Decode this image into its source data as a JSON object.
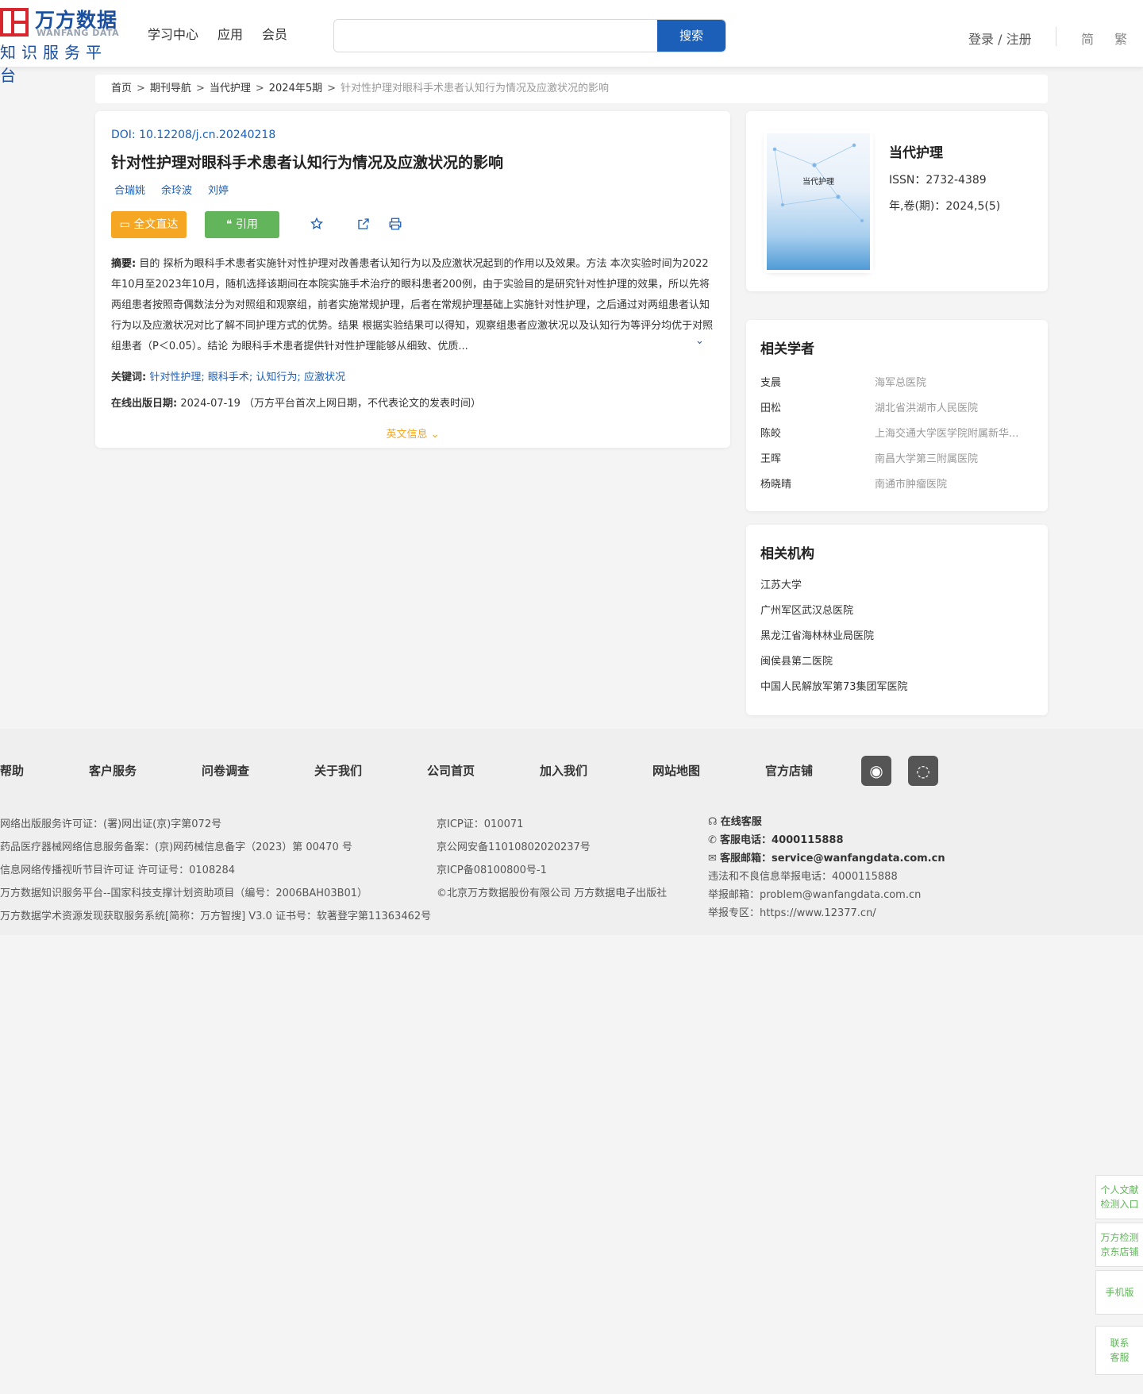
{
  "header": {
    "brand_cn": "万方数据",
    "brand_en": "WANFANG DATA",
    "brand_sub": "知识服务平台",
    "nav": [
      "学习中心",
      "应用",
      "会员"
    ],
    "search_placeholder": "",
    "search_button": "搜索",
    "login": "登录 / 注册",
    "lang_simplified": "简",
    "lang_traditional": "繁"
  },
  "breadcrumb": {
    "items": [
      "首页",
      "期刊导航",
      "当代护理",
      "2024年5期"
    ],
    "separator": ">",
    "current": "针对性护理对眼科手术患者认知行为情况及应激状况的影响"
  },
  "article": {
    "doi_label": "DOI: ",
    "doi": "10.12208/j.cn.20240218",
    "title": "针对性护理对眼科手术患者认知行为情况及应激状况的影响",
    "authors": [
      "合瑞姚",
      "余玲波",
      "刘婷"
    ],
    "full_text_button": "全文直达",
    "cite_button": "引用",
    "abstract_label": "摘要:",
    "abstract": " 目的 探析为眼科手术患者实施针对性护理对改善患者认知行为以及应激状况起到的作用以及效果。方法 本次实验时间为2022年10月至2023年10月，随机选择该期间在本院实施手术治疗的眼科患者200例，由于实验目的是研究针对性护理的效果，所以先将两组患者按照奇偶数法分为对照组和观察组，前者实施常规护理，后者在常规护理基础上实施针对性护理，之后通过对两组患者认知行为以及应激状况对比了解不同护理方式的优势。结果 根据实验结果可以得知，观察组患者应激状况以及认知行为等评分均优于对照组患者（P＜0.05）。结论 为眼科手术患者提供针对性护理能够从细致、优质...",
    "keywords_label": "关键词:",
    "keywords": [
      "针对性护理",
      "眼科手术",
      "认知行为",
      "应激状况"
    ],
    "pubdate_label": "在线出版日期:",
    "pubdate": "2024-07-19 （万方平台首次上网日期，不代表论文的发表时间）",
    "english_info": "英文信息"
  },
  "journal": {
    "cover_title": "当代护理",
    "name": "当代护理",
    "issn": "ISSN：2732-4389",
    "volume": "年,卷(期)：2024,5(5)"
  },
  "scholars": {
    "title": "相关学者",
    "items": [
      {
        "name": "支晨",
        "org": "海军总医院"
      },
      {
        "name": "田松",
        "org": "湖北省洪湖市人民医院"
      },
      {
        "name": "陈皎",
        "org": "上海交通大学医学院附属新华..."
      },
      {
        "name": "王晖",
        "org": "南昌大学第三附属医院"
      },
      {
        "name": "杨晓晴",
        "org": "南通市肿瘤医院"
      }
    ]
  },
  "institutions": {
    "title": "相关机构",
    "items": [
      "江苏大学",
      "广州军区武汉总医院",
      "黑龙江省海林林业局医院",
      "闽侯县第二医院",
      "中国人民解放军第73集团军医院"
    ]
  },
  "footer": {
    "nav": [
      "帮助",
      "客户服务",
      "问卷调查",
      "关于我们",
      "公司首页",
      "加入我们",
      "网站地图",
      "官方店铺"
    ],
    "col1": [
      "网络出版服务许可证：(署)网出证(京)字第072号",
      "药品医疗器械网络信息服务备案：(京)网药械信息备字（2023）第 00470 号",
      "信息网络传播视听节目许可证 许可证号：0108284",
      "万方数据知识服务平台--国家科技支撑计划资助项目（编号：2006BAH03B01）",
      "万方数据学术资源发现获取服务系统[简称：万方智搜] V3.0 证书号：软著登字第11363462号"
    ],
    "col2": [
      "京ICP证：010071",
      "京公网安备11010802020237号",
      "京ICP备08100800号-1",
      "©北京万方数据股份有限公司 万方数据电子出版社"
    ],
    "online_service": "在线客服",
    "phone_label": "客服电话：",
    "phone": "4000115888",
    "email_label": "客服邮箱：",
    "email": "service@wanfangdata.com.cn",
    "report_phone": "违法和不良信息举报电话：4000115888",
    "report_email": "举报邮箱：problem@wanfangdata.com.cn",
    "report_site": "举报专区：https://www.12377.cn/"
  },
  "side": {
    "personal_check_line1": "个人文献",
    "personal_check_line2": "检测入口",
    "jd_line1": "万方检测",
    "jd_line2": "京东店铺",
    "mobile": "手机版",
    "contact_line1": "联系",
    "contact_line2": "客服"
  }
}
